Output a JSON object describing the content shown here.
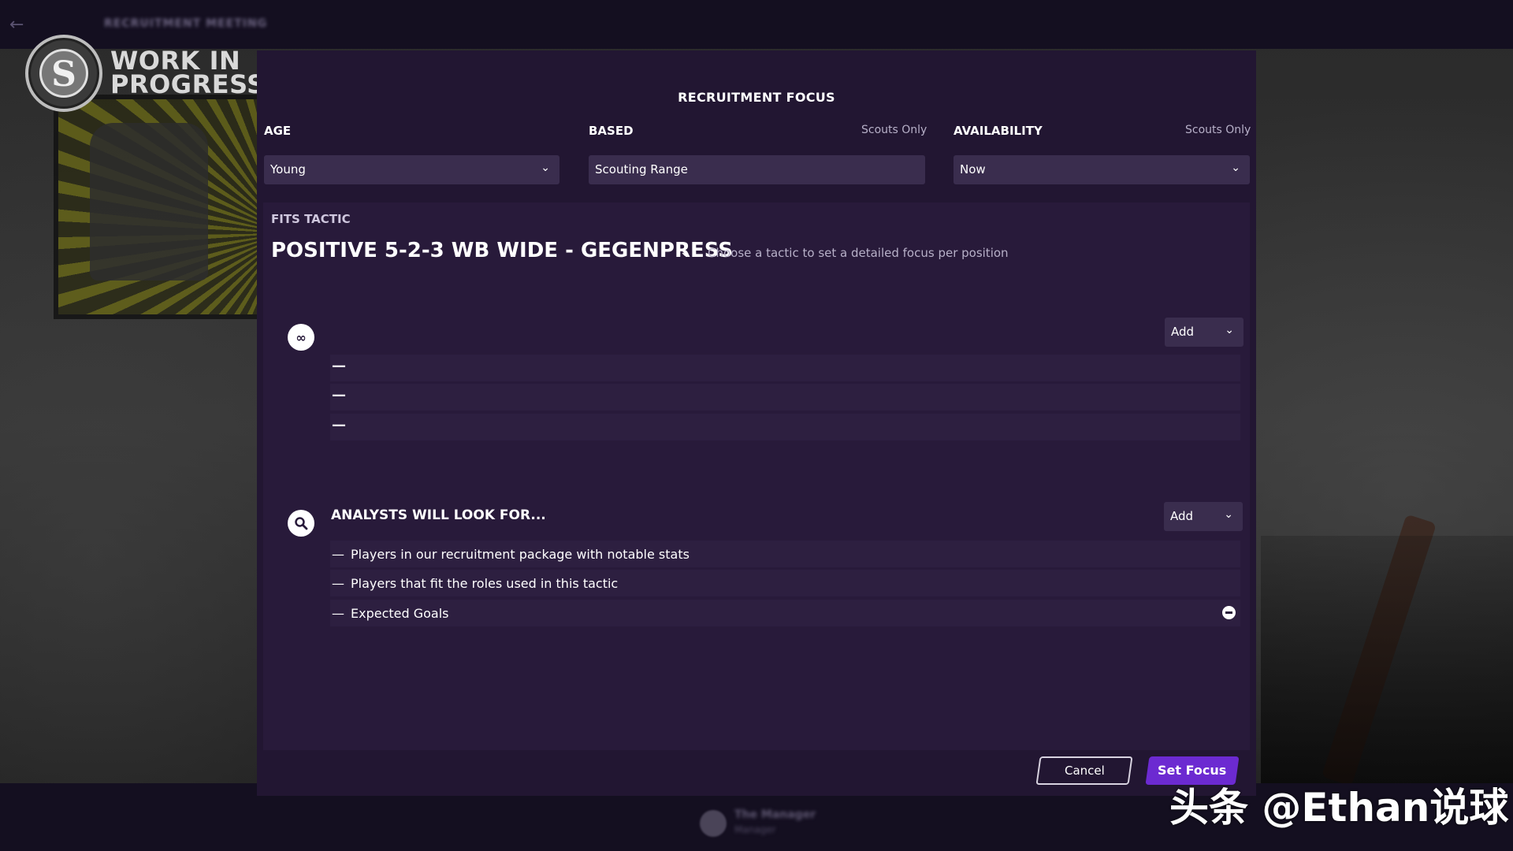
{
  "topbar": {
    "title": "RECRUITMENT MEETING"
  },
  "watermark": {
    "line1": "WORK IN",
    "line2": "PROGRESS",
    "corner": "头条 @Ethan说球"
  },
  "bottombar": {
    "manager_name": "The Manager",
    "manager_role": "Manager"
  },
  "modal": {
    "title": "RECRUITMENT FOCUS",
    "age": {
      "label": "AGE",
      "value": "Young"
    },
    "based": {
      "label": "BASED",
      "note": "Scouts Only",
      "value": "Scouting Range"
    },
    "availability": {
      "label": "AVAILABILITY",
      "note": "Scouts Only",
      "value": "Now"
    },
    "fits_tactic": {
      "label": "FITS TACTIC",
      "tactic_name": "POSITIVE 5-2-3 WB WIDE - GEGENPRESS",
      "hint": "Choose a tactic to set a detailed focus per position"
    },
    "scouts_section": {
      "add_label": "Add",
      "rows": [
        "—",
        "—",
        "—"
      ]
    },
    "analysts_section": {
      "heading": "ANALYSTS WILL LOOK FOR...",
      "add_label": "Add",
      "rows": [
        "Players in our recruitment package with notable stats",
        "Players that fit the roles used in this tactic",
        "Expected Goals"
      ]
    },
    "cancel_label": "Cancel",
    "set_focus_label": "Set Focus"
  },
  "icons": {
    "back": "back-arrow-icon",
    "dropdown": "chevron-down-icon",
    "scouts": "binoculars-icon",
    "analysts": "magnifier-icon",
    "remove": "remove-circle-icon"
  },
  "colors": {
    "modal_bg": "#221632",
    "panel_bg": "#281a3a",
    "field_bg": "#3a2d4e",
    "accent": "#6c2ad1",
    "topbar_bg": "#140f20"
  }
}
